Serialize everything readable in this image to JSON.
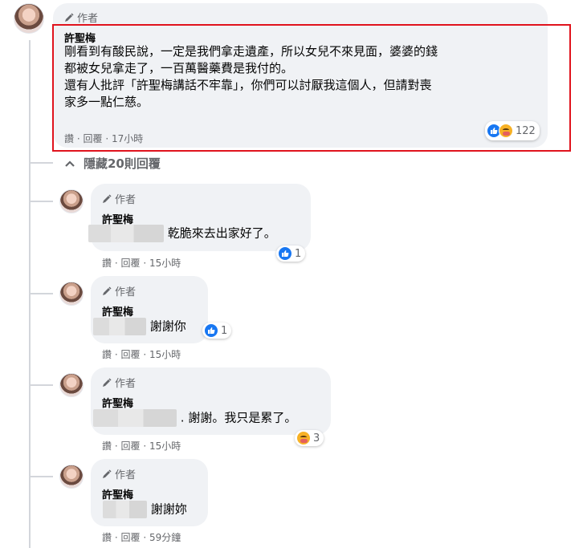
{
  "top_comment": {
    "author_badge": "作者",
    "name": "許聖梅",
    "lines": [
      "剛看到有酸民說，一定是我們拿走遺產，所以女兒不來見面，婆婆的錢",
      "都被女兒拿走了，一百萬醫藥費是我付的。",
      "還有人批評「許聖梅講話不牢靠」，你們可以討厭我這個人，但請對喪",
      "家多一點仁慈。"
    ],
    "actions": [
      "讚",
      "回覆",
      "17小時"
    ],
    "reaction_count": "122"
  },
  "hide_replies": {
    "label": "隱藏20則回覆"
  },
  "replies": [
    {
      "author_badge": "作者",
      "name": "許聖梅",
      "text": "乾脆來去出家好了。",
      "actions": [
        "讚",
        "回覆",
        "15小時"
      ],
      "reaction_count": "1",
      "reaction": "like"
    },
    {
      "author_badge": "作者",
      "name": "許聖梅",
      "text": "謝謝你",
      "actions": [
        "讚",
        "回覆",
        "15小時"
      ],
      "reaction_count": "1",
      "reaction": "like"
    },
    {
      "author_badge": "作者",
      "name": "許聖梅",
      "text": ". 謝謝。我只是累了。",
      "actions": [
        "讚",
        "回覆",
        "15小時"
      ],
      "reaction_count": "3",
      "reaction": "care"
    },
    {
      "author_badge": "作者",
      "name": "許聖梅",
      "text": "謝謝妳",
      "actions": [
        "讚",
        "回覆",
        "59分鐘"
      ],
      "reaction_count": "",
      "reaction": "none"
    }
  ],
  "meta_separator": "·",
  "colors": {
    "highlight": "#e0131d",
    "bubble": "#f0f2f5",
    "like": "#1877f2",
    "muted": "#65676b"
  }
}
